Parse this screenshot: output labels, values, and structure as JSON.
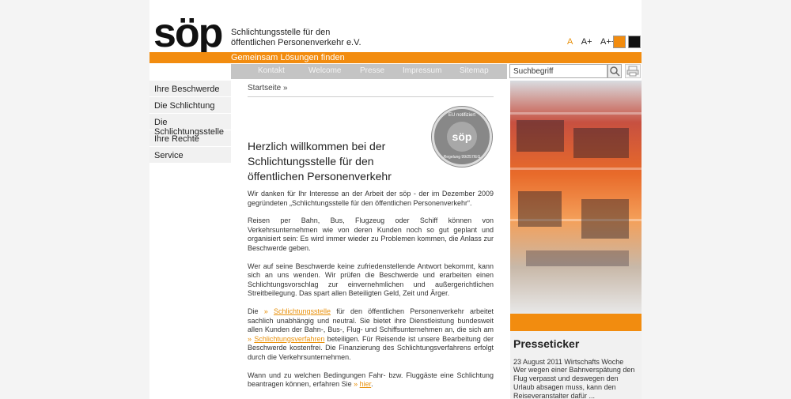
{
  "header": {
    "logo": "söp",
    "tagline_line1": "Schlichtungsstelle für den",
    "tagline_line2": "öffentlichen Personenverkehr e.V.",
    "font_sizes": [
      "A",
      "A+",
      "A++"
    ],
    "slogan": "Gemeinsam Lösungen finden"
  },
  "nav": {
    "items": [
      "Kontakt",
      "Welcome",
      "Presse",
      "Impressum",
      "Sitemap"
    ]
  },
  "search": {
    "value": "Suchbegriff"
  },
  "sidebar": {
    "items": [
      "Ihre Beschwerde",
      "Die Schlichtung",
      "Die Schlichtungsstelle",
      "Ihre Rechte",
      "Service"
    ]
  },
  "main": {
    "breadcrumb": "Startseite »",
    "badge_top": "EU notifiziert",
    "badge_center": "söp",
    "badge_bottom": "Regelung 99/257/EG",
    "title": "Herzlich willkommen bei der Schlichtungsstelle für den öffentlichen Personenverkehr",
    "p1": "Wir danken für Ihr Interesse an der Arbeit der söp - der im Dezember 2009 gegründeten „Schlichtungsstelle für den öffentlichen Personenverkehr“.",
    "p2": "Reisen per Bahn, Bus, Flugzeug oder Schiff können von Verkehrsunternehmen wie von deren Kunden noch so gut geplant und organisiert sein: Es wird immer wieder zu Problemen kommen, die Anlass zur Beschwerde geben.",
    "p3": "Wer auf seine Beschwerde keine zufriedenstellende Antwort bekommt, kann sich an uns wenden. Wir prüfen die Beschwerde und erarbeiten einen Schlichtungsvorschlag zur einvernehmlichen und außergerichtlichen Streitbeilegung. Das spart allen Beteiligten Geld, Zeit und Ärger.",
    "p4_a": "Die",
    "p4_link1": "Schlichtungsstelle",
    "p4_b": "für den öffentlichen Personenverkehr arbeitet sachlich unabhängig und neutral. Sie bietet ihre Dienstleistung bundesweit allen Kunden der Bahn-, Bus-, Flug- und Schiffsunternehmen an, die sich am",
    "p4_link2": "Schlichtungsverfahren",
    "p4_c": "beteiligen. Für Reisende ist unsere Bearbeitung der Beschwerde kostenfrei. Die Finanzierung des Schlichtungsverfahrens erfolgt durch die Verkehrsunternehmen.",
    "p5_a": "Wann und zu welchen Bedingungen Fahr- bzw. Fluggäste eine Schlichtung beantragen können, erfahren Sie",
    "p5_link": "hier",
    "p5_b": "."
  },
  "ticker": {
    "title": "Presseticker",
    "date": "23 August 2011 Wirtschafts Woche",
    "text": "Wer wegen einer Bahnverspätung den Flug verpasst und deswegen den Urlaub absagen muss, kann den Reiseveranstalter dafür ..."
  },
  "colors": {
    "accent": "#f28c0f",
    "nav_bg": "#c4c4c4"
  }
}
